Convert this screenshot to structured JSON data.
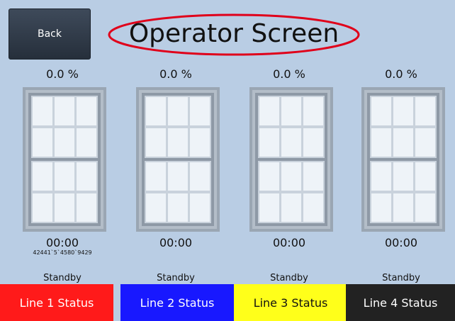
{
  "header": {
    "back_label": "Back",
    "title": "Operator Screen"
  },
  "colors": {
    "background": "#b9cde4",
    "title_ellipse": "#e0001a",
    "line1": "#ff1a1a",
    "line2": "#1818ff",
    "line3": "#ffff1a",
    "line4": "#222222"
  },
  "lines": [
    {
      "percent": "0.0 %",
      "time": "00:00",
      "serial": "42441`5`4580`9429",
      "state": "Standby",
      "status_label": "Line 1 Status"
    },
    {
      "percent": "0.0 %",
      "time": "00:00",
      "serial": "",
      "state": "Standby",
      "status_label": "Line 2 Status"
    },
    {
      "percent": "0.0 %",
      "time": "00:00",
      "serial": "",
      "state": "Standby",
      "status_label": "Line 3 Status"
    },
    {
      "percent": "0.0 %",
      "time": "00:00",
      "serial": "",
      "state": "Standby",
      "status_label": "Line 4 Status"
    }
  ]
}
